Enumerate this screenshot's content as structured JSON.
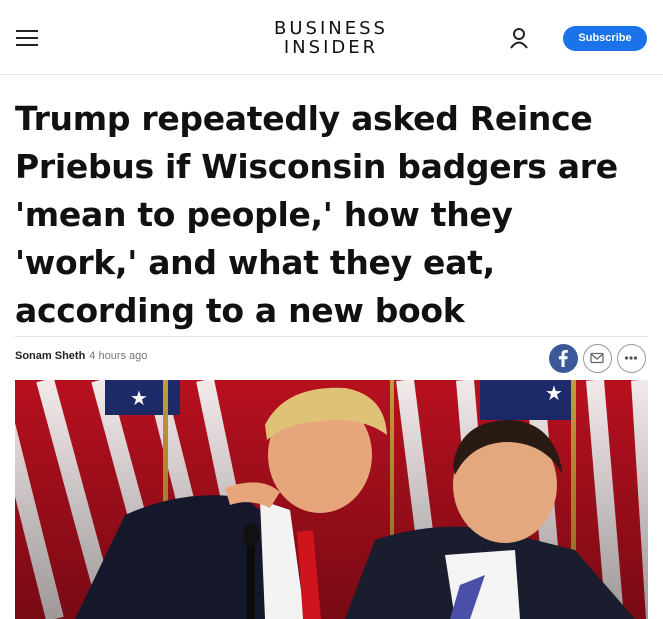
{
  "header": {
    "logo_line1": "BUSINESS",
    "logo_line2": "INSIDER",
    "menu_icon": "hamburger-menu-icon",
    "user_icon": "user-account-icon",
    "subscribe_label": "Subscribe",
    "subscribe_color": "#1a73e8"
  },
  "article": {
    "headline": "Trump repeatedly asked Reince Priebus if Wisconsin badgers are 'mean to people,' how they 'work,' and what they eat, according to a new book",
    "author": "Sonam Sheth",
    "timestamp": "4 hours ago"
  },
  "share": {
    "facebook_icon": "facebook-icon",
    "email_icon": "email-icon",
    "more_icon": "more-options-icon",
    "facebook_color": "#3b5998"
  },
  "hero_image": {
    "subject": "photo"
  }
}
